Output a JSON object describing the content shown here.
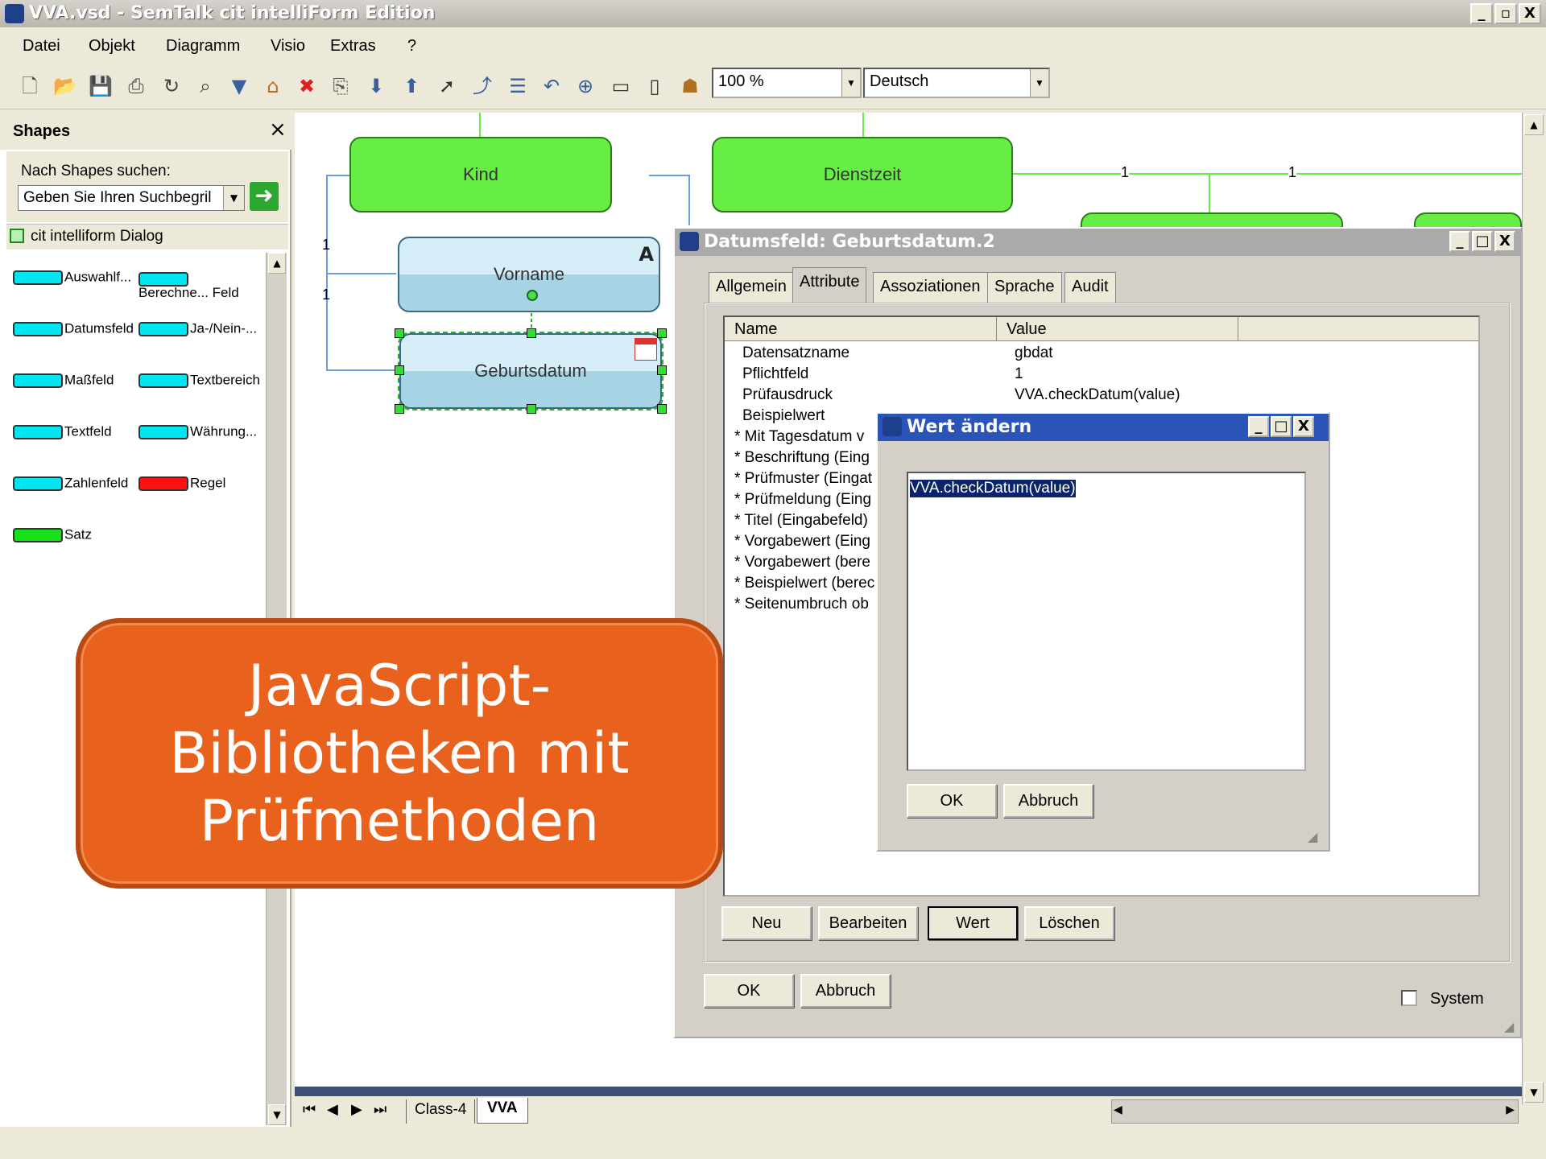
{
  "window": {
    "title": "VVA.vsd - SemTalk cit intelliForm Edition",
    "minimize": "_",
    "restore": "▫",
    "close": "X"
  },
  "menu": [
    "Datei",
    "Objekt",
    "Diagramm",
    "Visio",
    "Extras",
    "?"
  ],
  "toolbar": {
    "zoom_value": "100 %",
    "language_value": "Deutsch"
  },
  "shapes_panel": {
    "title": "Shapes",
    "close": "×",
    "search_label": "Nach Shapes suchen:",
    "search_value": "Geben Sie Ihren Suchbegril",
    "stencil_name": "cit intelliform Dialog",
    "items": [
      {
        "label": "Auswahlf...",
        "color": "#00e5f0"
      },
      {
        "label": "Berechne... Feld",
        "color": "#00e5f0"
      },
      {
        "label": "Datumsfeld",
        "color": "#00e5f0"
      },
      {
        "label": "Ja-/Nein-...",
        "color": "#00e5f0"
      },
      {
        "label": "Maßfeld",
        "color": "#00e5f0"
      },
      {
        "label": "Textbereich",
        "color": "#00e5f0"
      },
      {
        "label": "Textfeld",
        "color": "#00e5f0"
      },
      {
        "label": "Währung...",
        "color": "#00e5f0"
      },
      {
        "label": "Zahlenfeld",
        "color": "#00e5f0"
      },
      {
        "label": "Regel",
        "color": "#ff1010"
      },
      {
        "label": "Satz",
        "color": "#18e018"
      }
    ]
  },
  "canvas": {
    "nodes": {
      "kind": "Kind",
      "dienstzeit": "Dienstzeit",
      "vorname": "Vorname",
      "geburtsdatum": "Geburtsdatum"
    },
    "multiplicities": [
      "1",
      "1",
      "1",
      "1"
    ]
  },
  "attr_dialog": {
    "title": "Datumsfeld: Geburtsdatum.2",
    "tabs": [
      "Allgemein",
      "Attribute",
      "Assoziationen",
      "Sprache",
      "Audit"
    ],
    "columns": [
      "Name",
      "Value"
    ],
    "rows": [
      {
        "name": "Datensatzname",
        "value": "gbdat"
      },
      {
        "name": "Pflichtfeld",
        "value": "1"
      },
      {
        "name": "Prüfausdruck",
        "value": "VVA.checkDatum(value)"
      },
      {
        "name": "Beispielwert",
        "value": ""
      },
      {
        "name": "* Mit Tagesdatum v",
        "value": ""
      },
      {
        "name": "* Beschriftung (Eing",
        "value": ""
      },
      {
        "name": "* Prüfmuster (Eingat",
        "value": ""
      },
      {
        "name": "* Prüfmeldung (Eing",
        "value": ""
      },
      {
        "name": "* Titel (Eingabefeld)",
        "value": ""
      },
      {
        "name": "* Vorgabewert (Eing",
        "value": ""
      },
      {
        "name": "* Vorgabewert (bere",
        "value": ""
      },
      {
        "name": "* Beispielwert (berec",
        "value": ""
      },
      {
        "name": "* Seitenumbruch ob",
        "value": ""
      }
    ],
    "buttons": {
      "neu": "Neu",
      "bearbeiten": "Bearbeiten",
      "wert": "Wert",
      "loeschen": "Löschen",
      "ok": "OK",
      "abbruch": "Abbruch"
    },
    "system_label": "System"
  },
  "value_dialog": {
    "title": "Wert ändern",
    "value": "VVA.checkDatum(value)",
    "ok": "OK",
    "abbruch": "Abbruch"
  },
  "callout": {
    "line1": "JavaScript-",
    "line2": "Bibliotheken mit",
    "line3": "Prüfmethoden"
  },
  "page_tabs": [
    "Class-4",
    "VVA"
  ]
}
